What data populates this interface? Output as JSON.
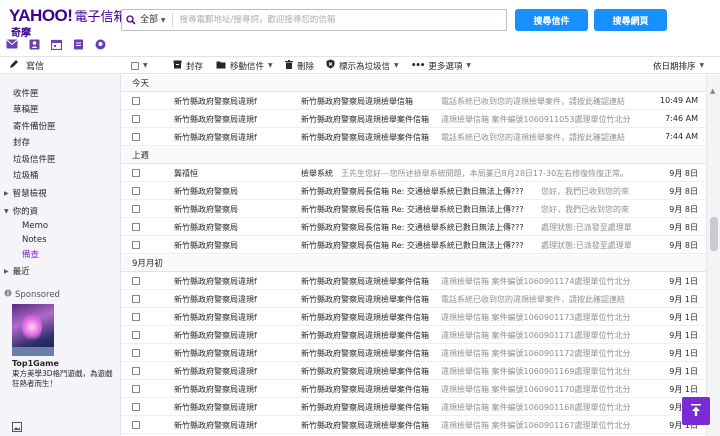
{
  "header": {
    "logo_brand": "YAHOO!",
    "logo_sub": "電子信箱",
    "logo_cn": "奇摩",
    "icons": [
      "mail-icon",
      "contacts-icon",
      "calendar-icon",
      "notepad-icon",
      "messenger-icon"
    ],
    "search": {
      "scope": "全部",
      "placeholder": "搜尋電郵地址/搜尋詞，歡迎搜尋您的信箱"
    },
    "search_mail_button": "搜尋信件",
    "search_web_button": "搜尋網頁"
  },
  "sidebar": {
    "compose": "寫信",
    "folders": [
      "收件匣",
      "草稿匣",
      "寄件備份匣",
      "封存",
      "垃圾信件匣",
      "垃圾桶"
    ],
    "smart_views": "智慧檢視",
    "my_folders": "你的資",
    "sub_folders": [
      "Memo",
      "Notes",
      "備查"
    ],
    "recent": "最近",
    "sponsored": "Sponsored",
    "ad_title": "Top1Game",
    "ad_text": "東方美學3D格鬥遊戲，為遊戲狂熱者而生！"
  },
  "toolbar": {
    "archive": "封存",
    "move": "移動信件",
    "delete": "刪除",
    "spam": "標示為垃圾信",
    "more": "更多選項",
    "sort": "依日期排序"
  },
  "messages": {
    "section_today": "今天",
    "section_last_week": "上週",
    "section_early_sept": "9月月初",
    "today": [
      {
        "sender": "新竹縣政府警察局違規f",
        "subject": "新竹縣政府警察局違規檢舉信箱",
        "preview": "電話系統已收到您的違規檢舉案件，請按此確認連結",
        "date": "10:49 AM"
      },
      {
        "sender": "新竹縣政府警察局違規f",
        "subject": "新竹縣政府警察局違規檢舉案件信箱",
        "preview": "違規檢舉信箱 案件編號1060911053處理單位竹北分局",
        "date": "7:46 AM"
      },
      {
        "sender": "新竹縣政府警察局違規f",
        "subject": "新竹縣政府警察局違規檢舉案件信箱",
        "preview": "電話系統已收到您的違規檢舉案件，請按此確認連結",
        "date": "7:44 AM"
      }
    ],
    "last_week": [
      {
        "sender": "龔禧恒",
        "subject": "檢舉系統",
        "preview": "王先生您好---您所述檢舉系統問題，本局業已8月28日17-30左右修復恢復正常。",
        "date": "9月 8日"
      },
      {
        "sender": "新竹縣政府警察局",
        "subject": "新竹縣政府警察局長信箱 Re: 交通檢舉系統已數日無法上傳???",
        "preview": "您好，我們已收到您的來",
        "date": "9月 8日"
      },
      {
        "sender": "新竹縣政府警察局",
        "subject": "新竹縣政府警察局長信箱 Re: 交通檢舉系統已數日無法上傳???",
        "preview": "您好，我們已收到您的來",
        "date": "9月 8日"
      },
      {
        "sender": "新竹縣政府警察局",
        "subject": "新竹縣政府警察局長信箱 Re: 交通檢舉系統已數日無法上傳???",
        "preview": "處理狀態:已派發至處理單",
        "date": "9月 8日"
      },
      {
        "sender": "新竹縣政府警察局",
        "subject": "新竹縣政府警察局長信箱 Re: 交通檢舉系統已數日無法上傳???",
        "preview": "處理狀態:已派發至處理單",
        "date": "9月 8日"
      }
    ],
    "early_sept": [
      {
        "sender": "新竹縣政府警察局違規f",
        "subject": "新竹縣政府警察局違規檢舉案件信箱",
        "preview": "違規檢舉信箱 案件編號1060901174處理單位竹北分局",
        "date": "9月 1日"
      },
      {
        "sender": "新竹縣政府警察局違規f",
        "subject": "新竹縣政府警察局違規檢舉案件信箱",
        "preview": "電話系統已收到您的違規檢舉案件，請按此確認連結",
        "date": "9月 1日"
      },
      {
        "sender": "新竹縣政府警察局違規f",
        "subject": "新竹縣政府警察局違規檢舉案件信箱",
        "preview": "違規檢舉信箱 案件編號1060901173處理單位竹北分局",
        "date": "9月 1日"
      },
      {
        "sender": "新竹縣政府警察局違規f",
        "subject": "新竹縣政府警察局違規檢舉案件信箱",
        "preview": "違規檢舉信箱 案件編號1060901171處理單位竹北分局",
        "date": "9月 1日"
      },
      {
        "sender": "新竹縣政府警察局違規f",
        "subject": "新竹縣政府警察局違規檢舉案件信箱",
        "preview": "違規檢舉信箱 案件編號1060901172處理單位竹北分局",
        "date": "9月 1日"
      },
      {
        "sender": "新竹縣政府警察局違規f",
        "subject": "新竹縣政府警察局違規檢舉案件信箱",
        "preview": "違規檢舉信箱 案件編號1060901169處理單位竹北分局",
        "date": "9月 1日"
      },
      {
        "sender": "新竹縣政府警察局違規f",
        "subject": "新竹縣政府警察局違規檢舉案件信箱",
        "preview": "違規檢舉信箱 案件編號1060901170處理單位竹北分局",
        "date": "9月 1日"
      },
      {
        "sender": "新竹縣政府警察局違規f",
        "subject": "新竹縣政府警察局違規檢舉案件信箱",
        "preview": "違規檢舉信箱 案件編號1060901168處理單位竹北分局",
        "date": "9月 1日"
      },
      {
        "sender": "新竹縣政府警察局違規f",
        "subject": "新竹縣政府警察局違規檢舉案件信箱",
        "preview": "違規檢舉信箱 案件編號1060901167處理單位竹北分局",
        "date": "9月 1日"
      }
    ]
  },
  "colors": {
    "brand_purple": "#400090",
    "accent_purple": "#7a2bd6",
    "button_blue": "#188fff"
  }
}
